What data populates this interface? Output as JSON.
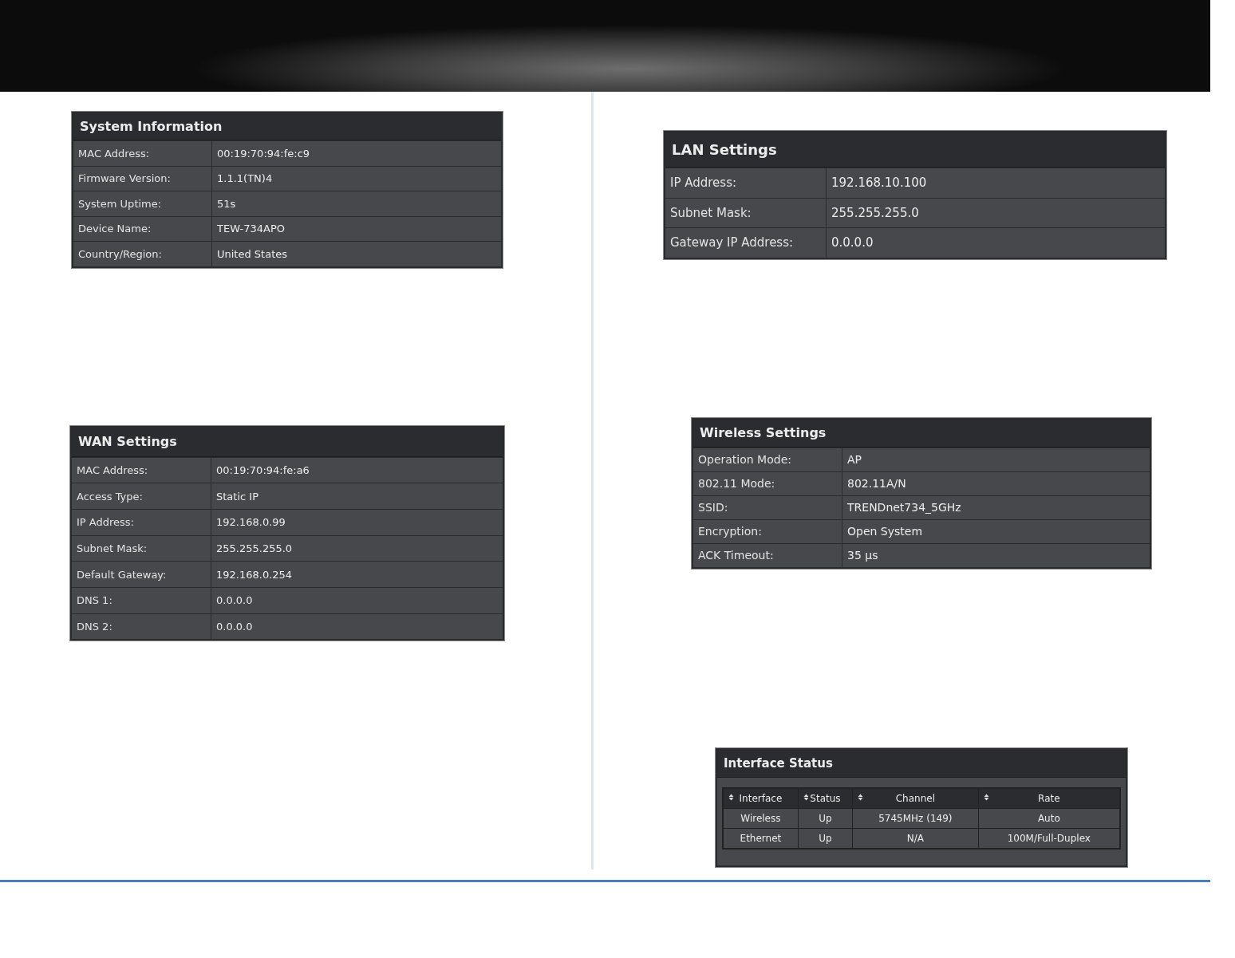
{
  "left_column": [
    {
      "kind": "settings",
      "title": "System Information",
      "rows": [
        {
          "label": "MAC Address:",
          "value": "00:19:70:94:fe:c9"
        },
        {
          "label": "Firmware Version:",
          "value": "1.1.1(TN)4"
        },
        {
          "label": "System Uptime:",
          "value": "51s"
        },
        {
          "label": "Device Name:",
          "value": "TEW-734APO"
        },
        {
          "label": "Country/Region:",
          "value": "United States"
        }
      ]
    },
    {
      "kind": "settings",
      "title": "WAN Settings",
      "rows": [
        {
          "label": "MAC Address:",
          "value": "00:19:70:94:fe:a6"
        },
        {
          "label": "Access Type:",
          "value": "Static IP"
        },
        {
          "label": "IP Address:",
          "value": "192.168.0.99"
        },
        {
          "label": "Subnet Mask:",
          "value": "255.255.255.0"
        },
        {
          "label": "Default Gateway:",
          "value": "192.168.0.254"
        },
        {
          "label": "DNS 1:",
          "value": "0.0.0.0"
        },
        {
          "label": "DNS 2:",
          "value": "0.0.0.0"
        }
      ]
    }
  ],
  "right_column": [
    {
      "kind": "settings",
      "title": "LAN Settings",
      "rows": [
        {
          "label": "IP Address:",
          "value": "192.168.10.100"
        },
        {
          "label": "Subnet Mask:",
          "value": "255.255.255.0"
        },
        {
          "label": "Gateway IP Address:",
          "value": "0.0.0.0"
        }
      ]
    },
    {
      "kind": "settings",
      "title": "Wireless Settings",
      "rows": [
        {
          "label": "Operation Mode:",
          "value": "AP"
        },
        {
          "label": "802.11 Mode:",
          "value": "802.11A/N"
        },
        {
          "label": "SSID:",
          "value": "TRENDnet734_5GHz"
        },
        {
          "label": "Encryption:",
          "value": "Open System"
        },
        {
          "label": "ACK Timeout:",
          "value": "35 μs"
        }
      ]
    },
    {
      "kind": "table",
      "title": "Interface Status",
      "columns": [
        "Interface",
        "Status",
        "Channel",
        "Rate"
      ],
      "rows": [
        [
          "Wireless",
          "Up",
          "5745MHz (149)",
          "Auto"
        ],
        [
          "Ethernet",
          "Up",
          "N/A",
          "100M/Full-Duplex"
        ]
      ]
    }
  ]
}
